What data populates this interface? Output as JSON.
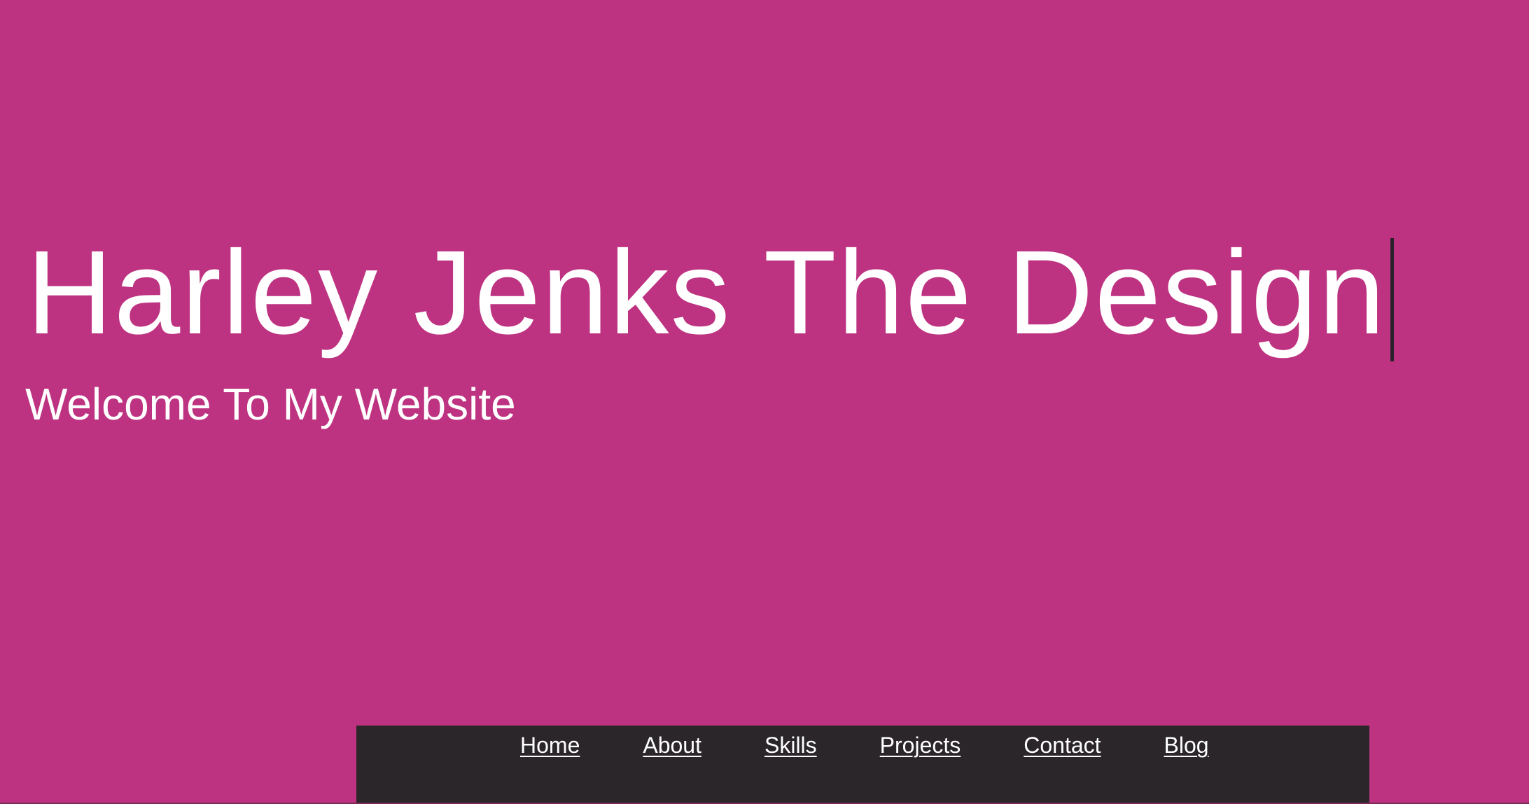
{
  "header": {
    "title": "Harley Jenks The Design",
    "subtitle": "Welcome To My Website"
  },
  "nav": {
    "items": [
      {
        "label": "Home"
      },
      {
        "label": "About"
      },
      {
        "label": "Skills"
      },
      {
        "label": "Projects"
      },
      {
        "label": "Contact"
      },
      {
        "label": "Blog"
      }
    ]
  },
  "colors": {
    "background": "#BE3381",
    "nav_background": "#2A262A",
    "text": "#FFFFFF",
    "caret": "#2A1F2B"
  }
}
